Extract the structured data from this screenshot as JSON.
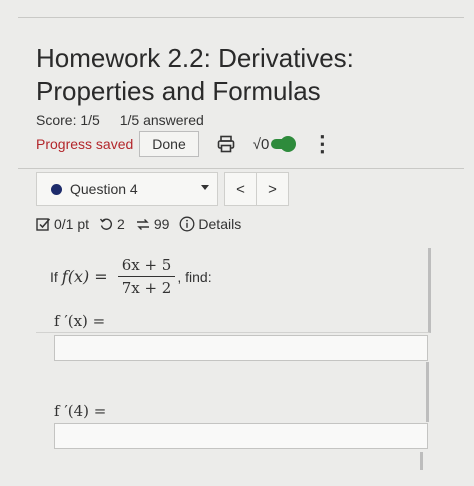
{
  "page": {
    "title": "Homework 2.2: Derivatives: Properties and Formulas",
    "score": "Score: 1/5",
    "answered": "1/5 answered",
    "progress_status": "Progress saved",
    "done_label": "Done",
    "math_toggle_label": "√0",
    "math_toggle_on": true
  },
  "question_nav": {
    "selected": "Question 4",
    "prev": "<",
    "next": ">"
  },
  "meta": {
    "points": "0/1 pt",
    "retries": "2",
    "attempts": "99",
    "details": "Details"
  },
  "question": {
    "prefix": "If",
    "function_name": "f(x) =",
    "numerator": "6x + 5",
    "denominator": "7x + 2",
    "suffix": ", find:",
    "part1_label": "f ′(x) =",
    "part1_value": "",
    "part2_label": "f ′(4) =",
    "part2_value": ""
  },
  "colors": {
    "progress_saved": "#b3262b",
    "toggle": "#2e8b3c",
    "question_dot": "#1d2b6b"
  }
}
